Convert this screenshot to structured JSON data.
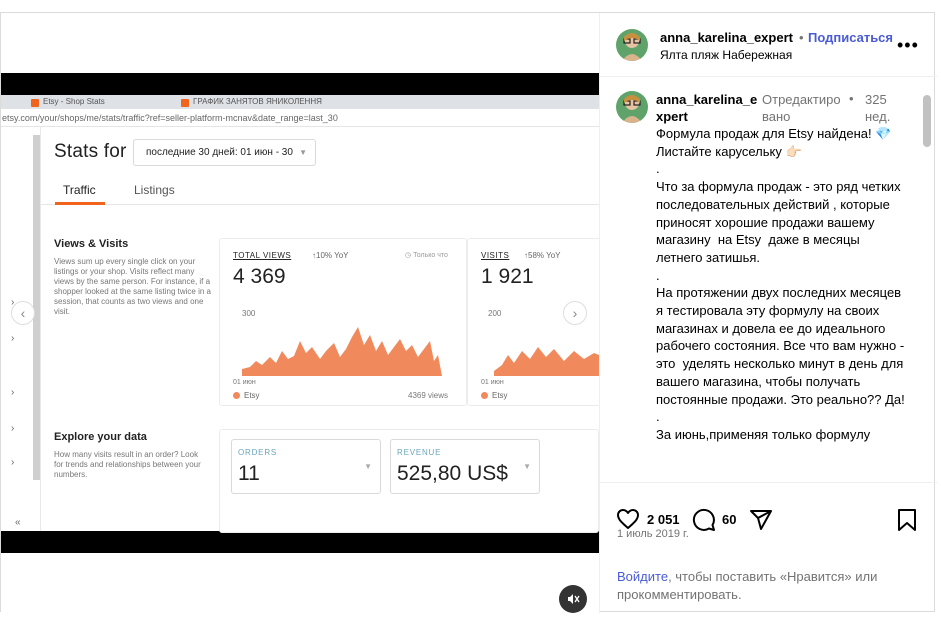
{
  "video": {
    "browser_tabs": [
      "Etsy - Shop Stats",
      "ГРАФИК ЗАНЯТОВ ЯНИКОЛЕННЯ"
    ],
    "url": "etsy.com/your/shops/me/stats/traffic?ref=seller-platform-mcnav&date_range=last_30",
    "stats_title": "Stats for",
    "date_range": "последние 30 дней: 01 июн - 30",
    "tabs": [
      "Traffic",
      "Listings"
    ],
    "views_visits": {
      "heading": "Views & Visits",
      "text": "Views sum up every single click on your listings or your shop. Visits reflect many views by the same person. For instance, if a shopper looked at the same listing twice in a session, that counts as two views and one visit."
    },
    "total_views": {
      "label": "TOTAL VIEWS",
      "delta": "10% YoY",
      "note": "Только что",
      "value": "4 369",
      "axis_top": "300",
      "axis_start": "01 июн",
      "legend": "Etsy",
      "legend_value": "4369 views"
    },
    "visits": {
      "label": "VISITS",
      "delta": "58% YoY",
      "value": "1 921",
      "axis_top": "200",
      "axis_start": "01 июн",
      "legend": "Etsy"
    },
    "explore": {
      "heading": "Explore your data",
      "text": "How many visits result in an order? Look for trends and relationships between your numbers."
    },
    "orders": {
      "label": "ORDERS",
      "value": "11"
    },
    "revenue": {
      "label": "REVENUE",
      "value": "525,80 US$"
    },
    "accent_color": "#f1641e"
  },
  "post": {
    "username": "anna_karelina_expert",
    "follow_label": "Подписаться",
    "location": "Ялта пляж Набережная",
    "caption_user": "anna_karelina_expert",
    "edited": "Отредактировано",
    "age": "325 нед.",
    "caption": "Формула продаж для Etsy найдена! 💎\nЛистайте карусельку 👉🏻\n.\nЧто за формула продаж - это ряд четких последовательных действий , которые приносят хорошие продажи вашему магазину  на Etsy  даже в месяцы летнего затишья.\n.\nНа протяжении двух последних месяцев я тестировала эту формулу на своих магазинах и довела ее до идеального рабочего состояния. Все что вам нужно - это  уделять несколько минут в день для вашего магазина, чтобы получать постоянные продажи. Это реально?? Да!\n.\nЗа июнь,применяя только формулу",
    "likes": "2 051",
    "comments": "60",
    "date": "1 июль 2019 г.",
    "login_link": "Войдите",
    "login_text": ", чтобы поставить «Нравится» или прокомментировать.",
    "link_color": "#4a5bd4"
  }
}
